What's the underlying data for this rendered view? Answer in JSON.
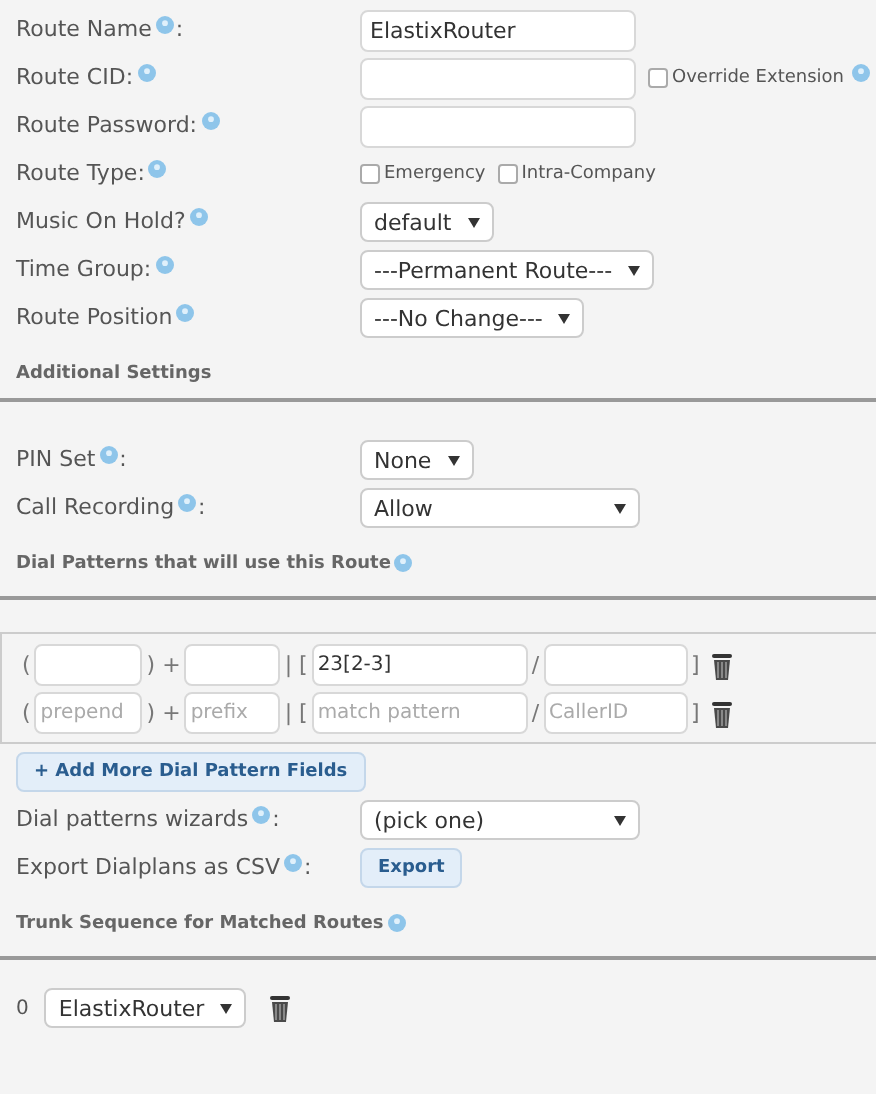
{
  "general": [
    {
      "kind": "text",
      "label": "Route Name",
      "help": true,
      "suffix": ":",
      "value": "ElastixRouter"
    },
    {
      "kind": "text",
      "label": "Route CID:",
      "help": true,
      "extra": {
        "label": "Override Extension",
        "checked": false,
        "help": true
      }
    },
    {
      "kind": "text",
      "label": "Route Password:",
      "help": true
    },
    {
      "kind": "checkboxes",
      "label": "Route Type:",
      "help": true,
      "options": [
        {
          "label": "Emergency",
          "checked": false
        },
        {
          "label": "Intra-Company",
          "checked": false
        }
      ]
    },
    {
      "kind": "select",
      "label": "Music On Hold?",
      "help": true,
      "value": "default"
    },
    {
      "kind": "select",
      "label": "Time Group:",
      "help": true,
      "value": "---Permanent Route---"
    },
    {
      "kind": "select",
      "label": "Route Position",
      "help": true,
      "value": "---No Change---"
    }
  ],
  "additional": {
    "heading": "Additional Settings",
    "fields": [
      {
        "kind": "select",
        "label": "PIN Set",
        "help": true,
        "suffix": ":",
        "value": "None"
      },
      {
        "kind": "select",
        "label": "Call Recording",
        "help": true,
        "suffix": ":",
        "value": "Allow"
      }
    ]
  },
  "dial_patterns": {
    "heading": "Dial Patterns that will use this Route",
    "rows": [
      {
        "prepend": {},
        "prefix": {},
        "match": {
          "value": "23[2-3]"
        },
        "callerid": {}
      },
      {
        "prepend": {
          "placeholder": "prepend"
        },
        "prefix": {
          "placeholder": "prefix"
        },
        "match": {
          "placeholder": "match pattern"
        },
        "callerid": {
          "placeholder": "CallerID"
        }
      }
    ],
    "open_paren": "(",
    "plus": ") +",
    "bar": "| [",
    "slash": "/",
    "close": "]",
    "add_button": "+ Add More Dial Pattern Fields",
    "wizard": {
      "label": "Dial patterns wizards",
      "suffix": ":",
      "value": "(pick one)"
    },
    "export": {
      "label": "Export Dialplans as CSV",
      "suffix": ":",
      "button": "Export"
    }
  },
  "trunks": {
    "heading": "Trunk Sequence for Matched Routes",
    "rows": [
      {
        "index": "0",
        "value": "ElastixRouter"
      }
    ]
  }
}
